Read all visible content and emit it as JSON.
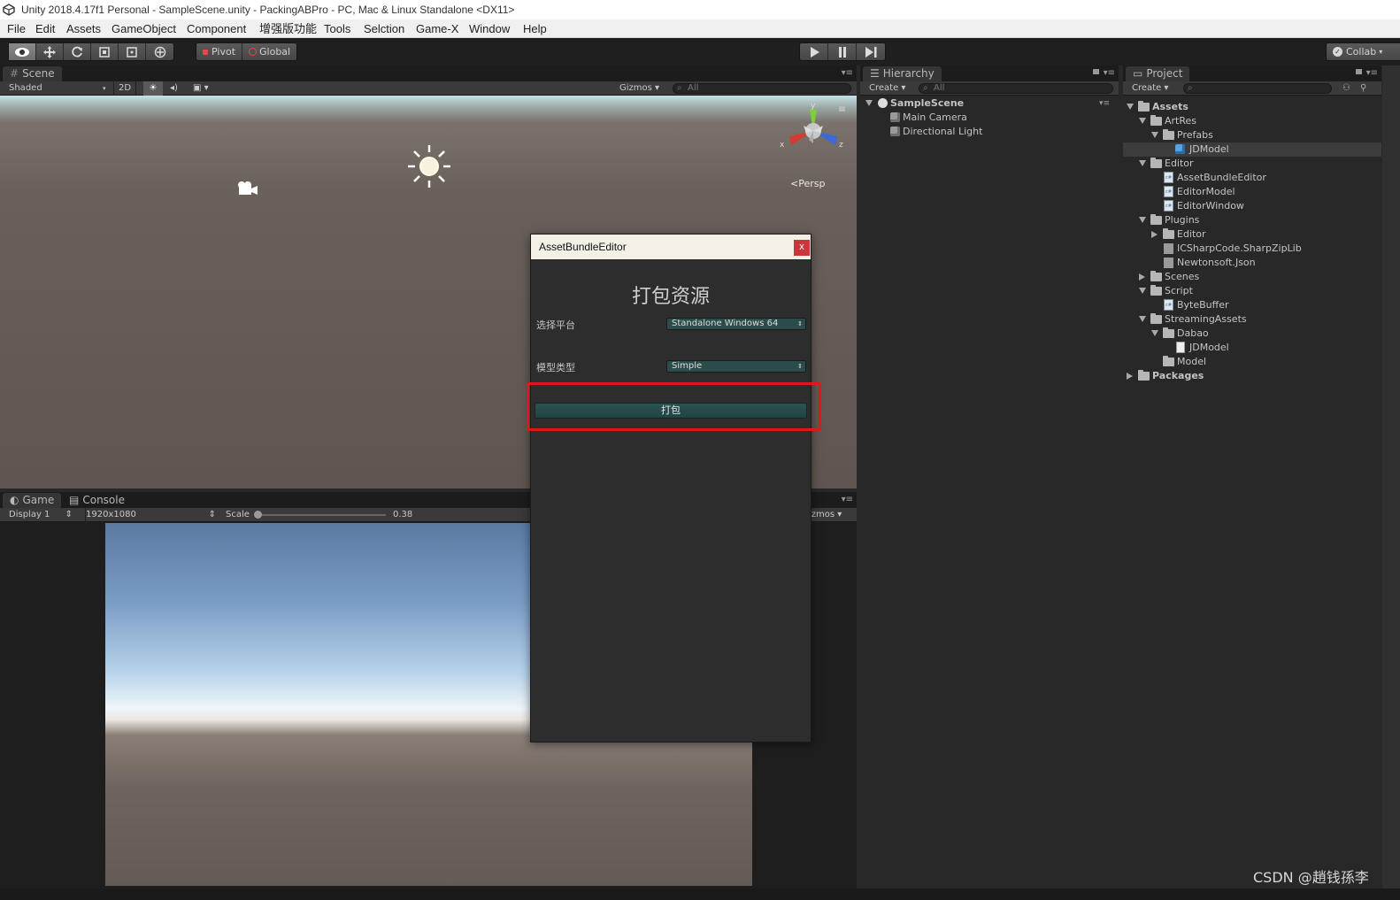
{
  "window": {
    "title": "Unity 2018.4.17f1 Personal - SampleScene.unity - PackingABPro - PC, Mac & Linux Standalone <DX11>"
  },
  "menu": [
    "File",
    "Edit",
    "Assets",
    "GameObject",
    "Component",
    "增强版功能",
    "Tools",
    "Selction",
    "Game-X",
    "Window",
    "Help"
  ],
  "toolbar": {
    "pivot": "Pivot",
    "global": "Global",
    "collab": "Collab"
  },
  "scene": {
    "tab": "Scene",
    "shading": "Shaded",
    "mode2d": "2D",
    "gizmos": "Gizmos",
    "search_placeholder": "All",
    "persp": "Persp",
    "axis_y": "y",
    "axis_x": "x",
    "axis_z": "z"
  },
  "game": {
    "tab_game": "Game",
    "tab_console": "Console",
    "display": "Display 1",
    "resolution": "1920x1080",
    "scale_label": "Scale",
    "scale_value": "0.38",
    "gizmos": "izmos"
  },
  "hierarchy": {
    "tab": "Hierarchy",
    "create": "Create",
    "search_placeholder": "All",
    "scene": "SampleScene",
    "items": [
      "Main Camera",
      "Directional Light"
    ]
  },
  "project": {
    "tab": "Project",
    "create": "Create",
    "tree": [
      {
        "label": "Assets",
        "bold": true
      },
      {
        "label": "ArtRes"
      },
      {
        "label": "Prefabs"
      },
      {
        "label": "JDModel"
      },
      {
        "label": "Editor"
      },
      {
        "label": "AssetBundleEditor"
      },
      {
        "label": "EditorModel"
      },
      {
        "label": "EditorWindow"
      },
      {
        "label": "Plugins"
      },
      {
        "label": "Editor"
      },
      {
        "label": "ICSharpCode.SharpZipLib"
      },
      {
        "label": "Newtonsoft.Json"
      },
      {
        "label": "Scenes"
      },
      {
        "label": "Script"
      },
      {
        "label": "ByteBuffer"
      },
      {
        "label": "StreamingAssets"
      },
      {
        "label": "Dabao"
      },
      {
        "label": "JDModel"
      },
      {
        "label": "Model"
      },
      {
        "label": "Packages",
        "bold": true
      }
    ]
  },
  "dialog": {
    "title": "AssetBundleEditor",
    "close": "x",
    "heading": "打包资源",
    "platform_label": "选择平台",
    "platform_value": "Standalone Windows 64",
    "model_label": "模型类型",
    "model_value": "Simple",
    "build_button": "打包"
  },
  "watermark": "CSDN @趙钱孫李",
  "colors": {
    "highlight_box": "#e0161a",
    "dialog_title_bg": "#f5f0e6",
    "button_teal": "#1f4444"
  }
}
